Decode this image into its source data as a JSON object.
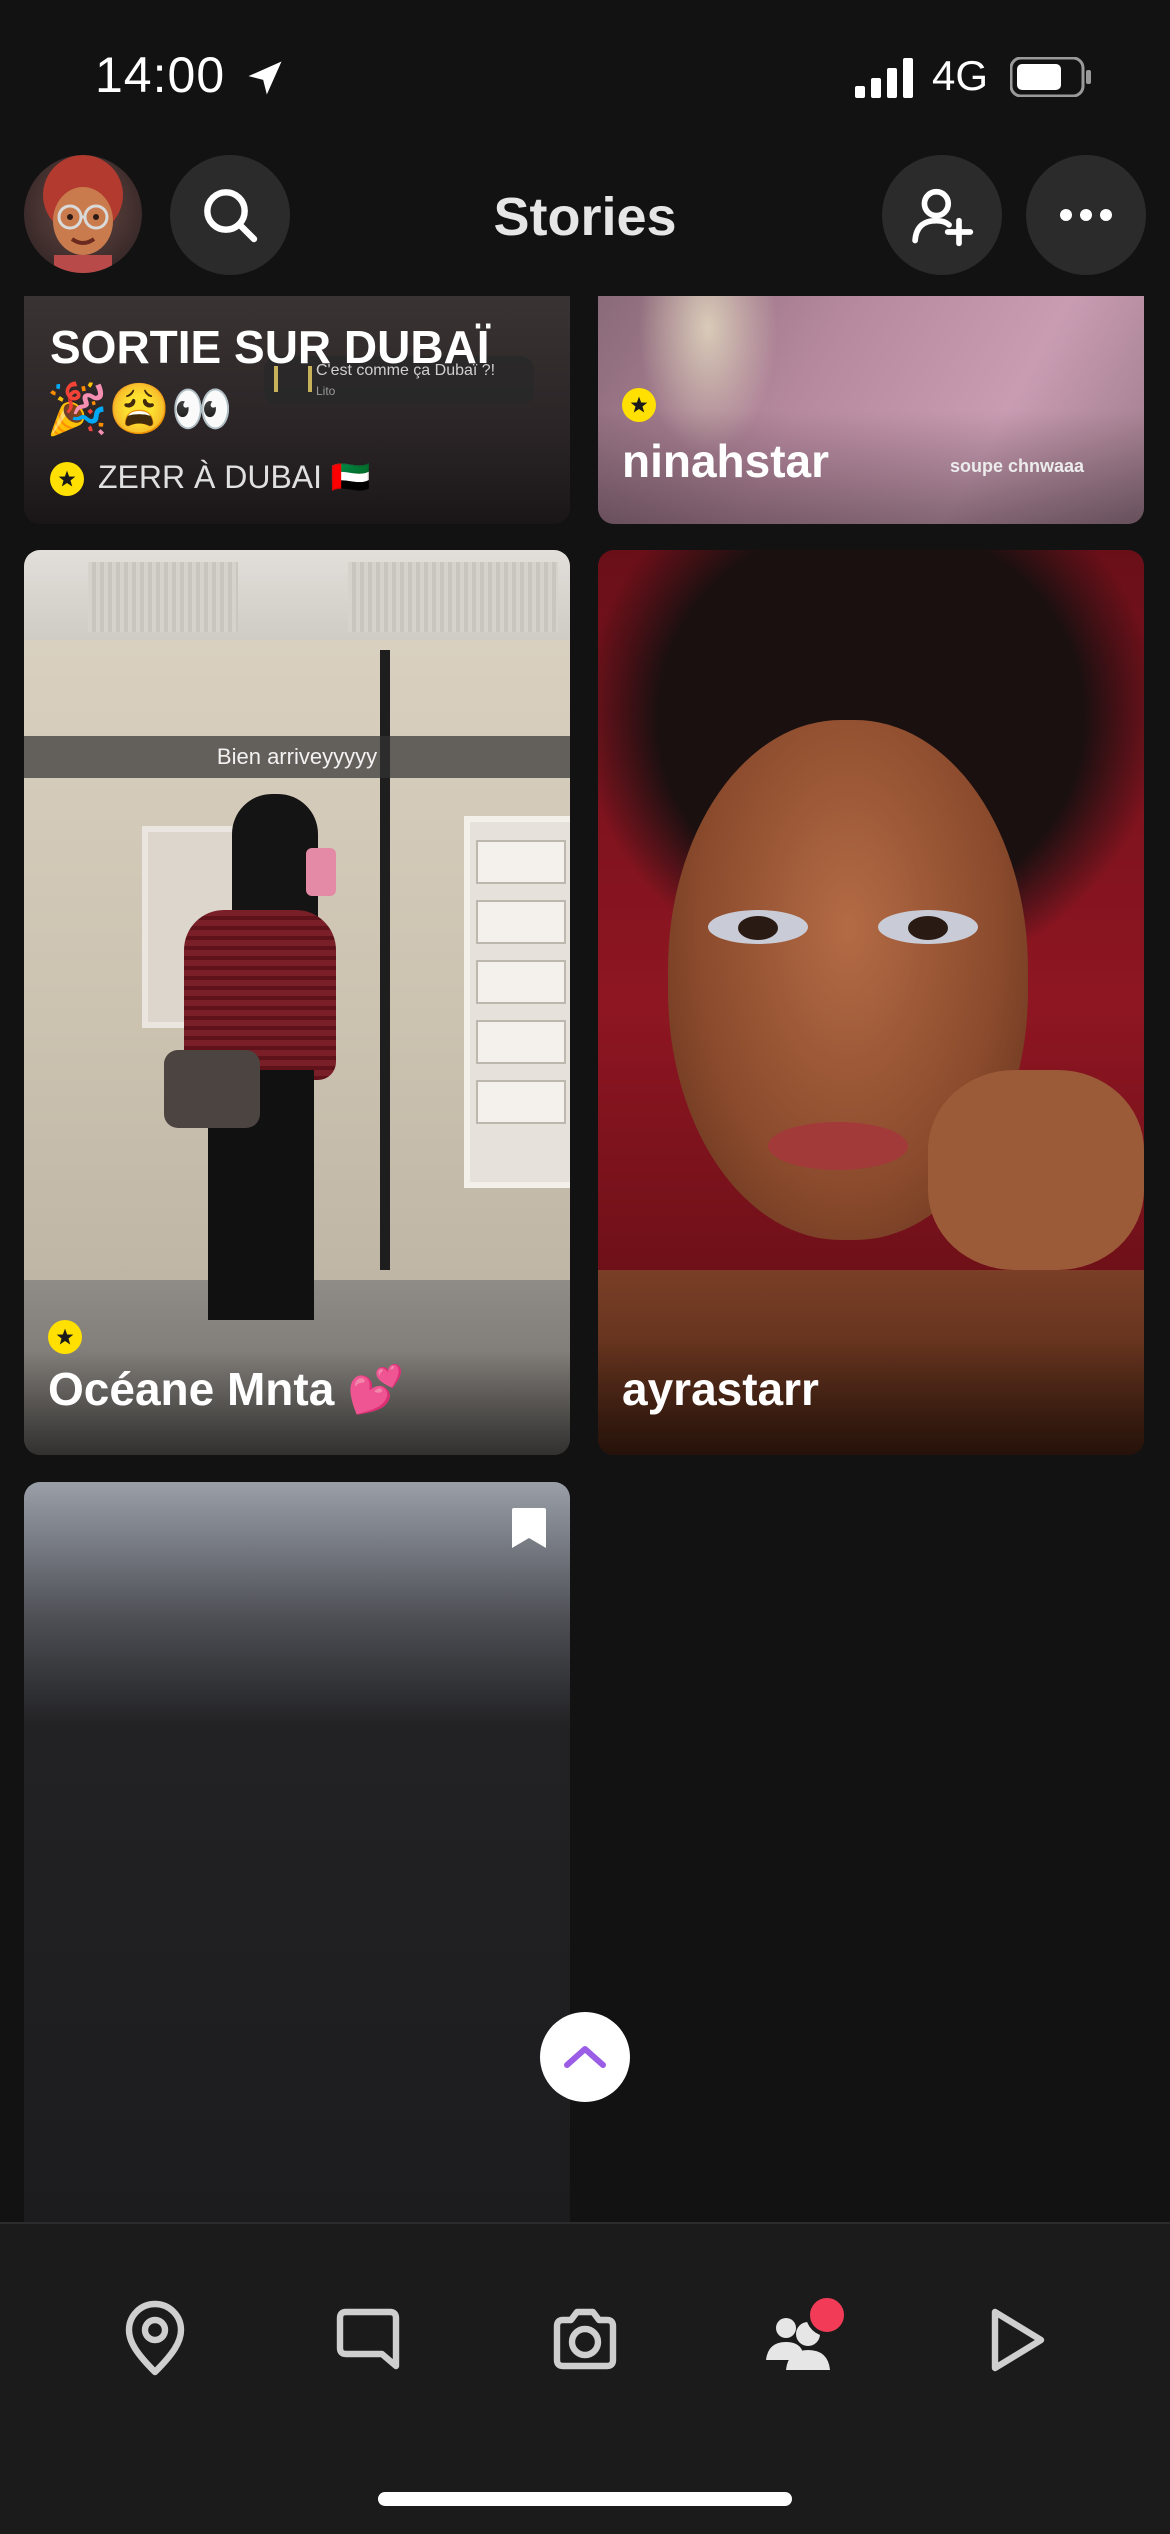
{
  "status": {
    "time": "14:00",
    "network": "4G"
  },
  "header": {
    "title": "Stories"
  },
  "stories": [
    {
      "title": "SORTIE SUR DUBAÏ",
      "emoji": "🎉😩👀",
      "subtitle": "ZERR À DUBAI 🇦🇪",
      "overlay_text": "C'est comme ça Dubaï ?!",
      "overlay_sub": "Lito"
    },
    {
      "name": "ninahstar",
      "caption": "soupe chnwaaa"
    },
    {
      "name": "Océane Mnta 💕",
      "caption": "Bien arriveyyyyy"
    },
    {
      "name": "ayrastarr"
    },
    {
      "name": ""
    }
  ],
  "nav": [
    "map-icon",
    "chat-icon",
    "camera-icon",
    "friends-icon",
    "spotlight-icon"
  ],
  "colors": {
    "accent": "#ffe000",
    "notification": "#f23c57",
    "purple": "#9b5de5"
  }
}
